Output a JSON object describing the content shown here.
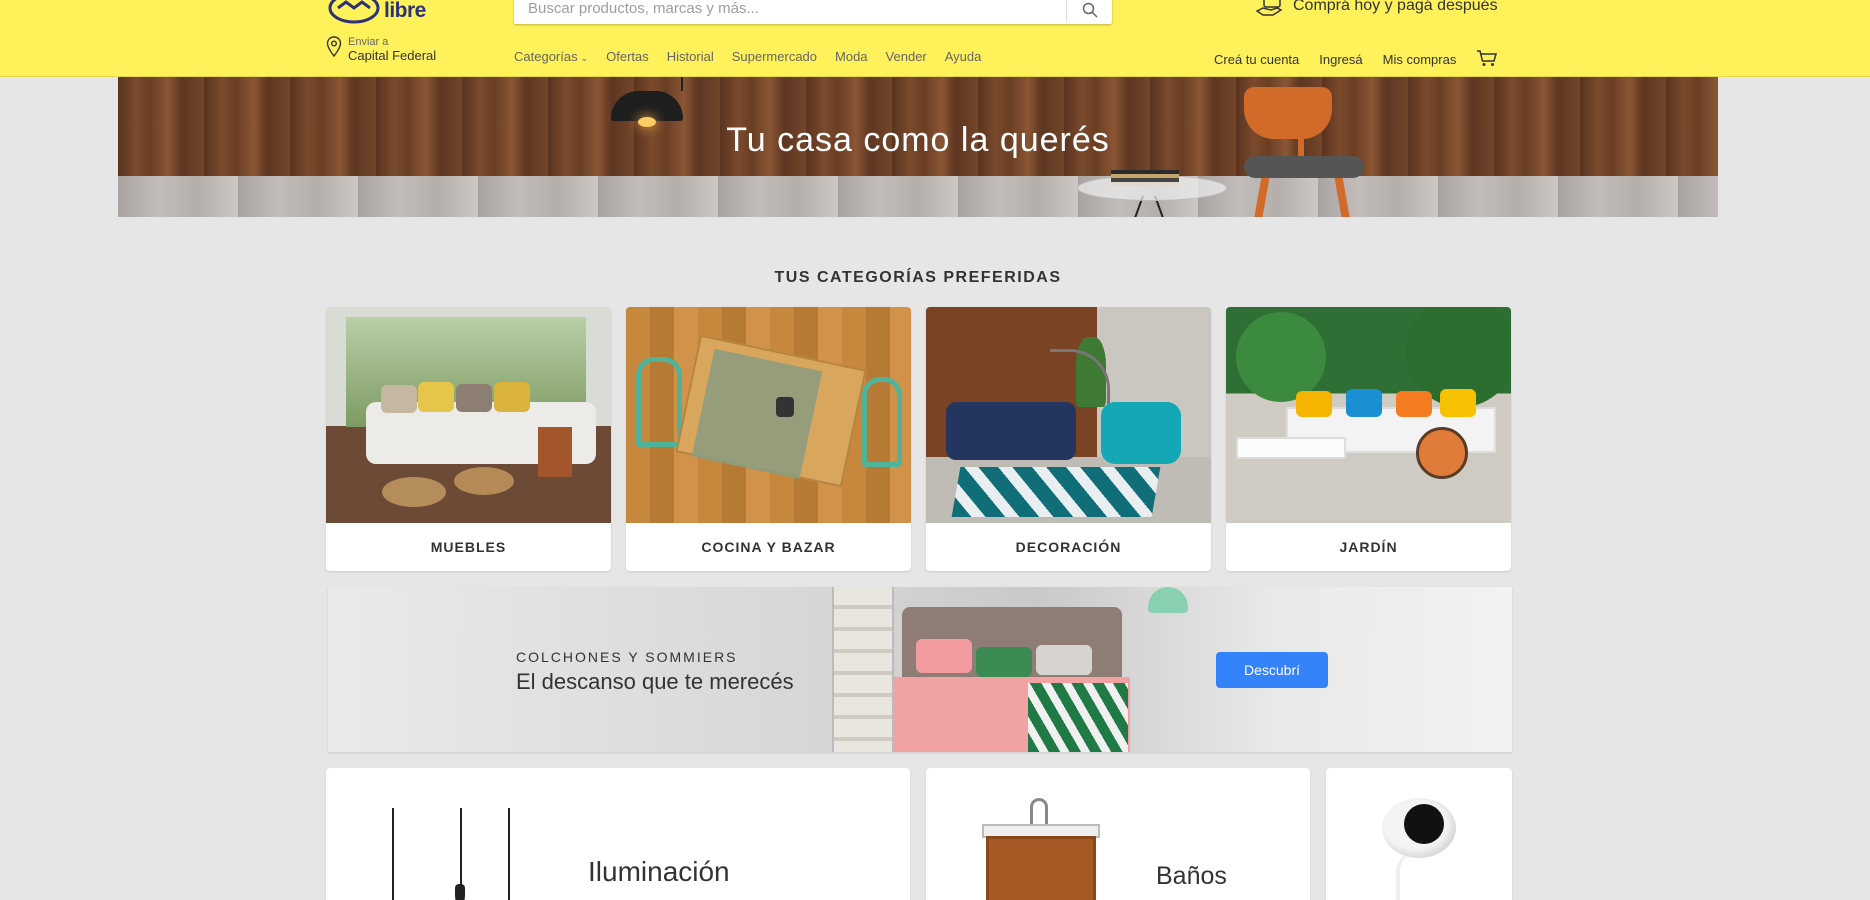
{
  "header": {
    "logo_text": "mercado libre",
    "search_placeholder": "Buscar productos, marcas y más...",
    "promo_text": "Comprá hoy y pagá después",
    "shipping": {
      "label": "Enviar a",
      "location": "Capital Federal"
    },
    "nav": [
      "Categorías",
      "Ofertas",
      "Historial",
      "Supermercado",
      "Moda",
      "Vender",
      "Ayuda"
    ],
    "account": {
      "create": "Creá tu cuenta",
      "login": "Ingresá",
      "purchases": "Mis compras"
    },
    "colors": {
      "background": "#fff159",
      "brand_blue": "#2d3277"
    }
  },
  "hero": {
    "title": "Tu casa como la querés"
  },
  "section": {
    "title": "TUS CATEGORÍAS PREFERIDAS"
  },
  "categories": [
    {
      "label": "MUEBLES"
    },
    {
      "label": "COCINA Y BAZAR"
    },
    {
      "label": "DECORACIÓN"
    },
    {
      "label": "JARDÍN"
    }
  ],
  "banner": {
    "kicker": "COLCHONES Y SOMMIERS",
    "title": "El descanso que te merecés",
    "button": "Descubrí",
    "button_color": "#3483fa"
  },
  "tiles": [
    {
      "label": "Iluminación"
    },
    {
      "label": "Baños"
    },
    {
      "label": ""
    }
  ]
}
